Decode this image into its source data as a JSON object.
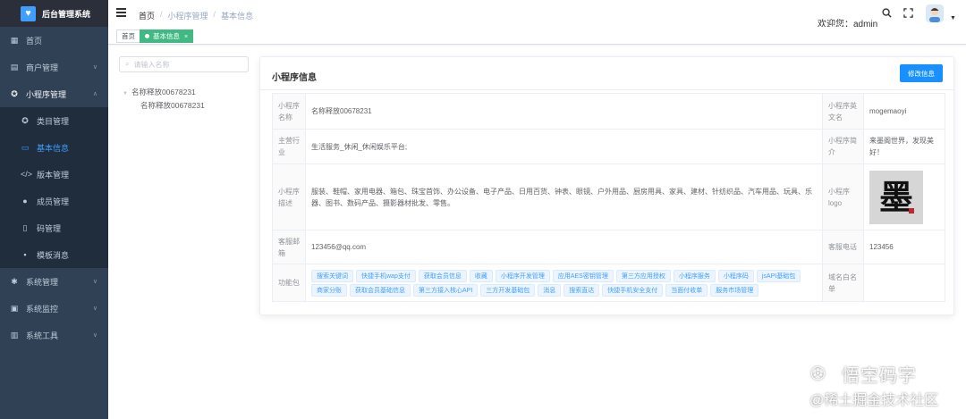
{
  "app": {
    "title": "后台管理系统",
    "logo_icon": "heart-icon",
    "brand_color": "#409eff",
    "sidebar_color": "#304156",
    "active_tag_color": "#42b983"
  },
  "sidebar": {
    "items": [
      {
        "label": "首页",
        "icon": "dashboard-icon"
      },
      {
        "label": "商户管理",
        "icon": "shop-icon"
      },
      {
        "label": "小程序管理",
        "icon": "miniapp-icon"
      },
      {
        "label": "系统管理",
        "icon": "gear-icon"
      },
      {
        "label": "系统监控",
        "icon": "monitor-icon"
      },
      {
        "label": "系统工具",
        "icon": "toolbox-icon"
      }
    ],
    "sub_items": [
      {
        "label": "类目管理",
        "icon": "category-icon"
      },
      {
        "label": "基本信息",
        "icon": "info-icon"
      },
      {
        "label": "版本管理",
        "icon": "code-icon"
      },
      {
        "label": "成员管理",
        "icon": "user-icon"
      },
      {
        "label": "码管理",
        "icon": "phone-icon"
      },
      {
        "label": "模板消息",
        "icon": "message-icon"
      }
    ],
    "active_sub": "基本信息"
  },
  "header": {
    "breadcrumb": [
      "首页",
      "小程序管理",
      "基本信息"
    ],
    "welcome": "欢迎您：admin",
    "icons": [
      "search-icon",
      "fullscreen-icon",
      "avatar",
      "caret-down-icon"
    ]
  },
  "tags": {
    "items": [
      {
        "label": "首页",
        "active": false
      },
      {
        "label": "基本信息",
        "active": true
      }
    ]
  },
  "tree": {
    "search_placeholder": "请输入名称",
    "root": "名称释放00678231",
    "child": "名称释放00678231"
  },
  "card": {
    "title": "小程序信息",
    "edit_button": "修改信息",
    "rows": {
      "name_label": "小程序名称",
      "name_value": "名称释放00678231",
      "en_name_label": "小程序英文名",
      "en_name_value": "mogemaoyi",
      "industry_label": "主营行业",
      "industry_value": "生活服务_休闲_休闲娱乐平台;",
      "intro_label": "小程序简介",
      "intro_value": "来墨阁世界，发现美好！",
      "desc_label": "小程序描述",
      "desc_value": "服装、鞋帽、家用电器、箱包、珠宝首饰、办公设备、电子产品、日用百货、钟表、眼镜、户外用品、厨房用具、家具、建材、针纺织品、汽车用品、玩具、乐器、图书、数码产品、摄影器材批发、零售。",
      "logo_label": "小程序logo",
      "logo_glyph": "墨",
      "email_label": "客服邮箱",
      "email_value": "123456@qq.com",
      "phone_label": "客服电话",
      "phone_value": "123456",
      "func_label": "功能包",
      "domain_label": "域名白名单",
      "func_chips": [
        "搜索关键词",
        "快捷手机wap支付",
        "获取会员信息",
        "收藏",
        "小程序开发管理",
        "应用AES密钥管理",
        "第三方应用授权",
        "小程序服务",
        "小程序码",
        "jsAPI基础包",
        "商家分账",
        "获取会员基础信息",
        "第三方接入核心API",
        "三方开发基础包",
        "消息",
        "搜索直达",
        "快捷手机安全支付",
        "当面付收单",
        "服务市场管理"
      ]
    }
  },
  "watermark": {
    "line1": "悟空码字",
    "line2": "@稀土掘金技术社区",
    "icon": "wechat-icon"
  }
}
